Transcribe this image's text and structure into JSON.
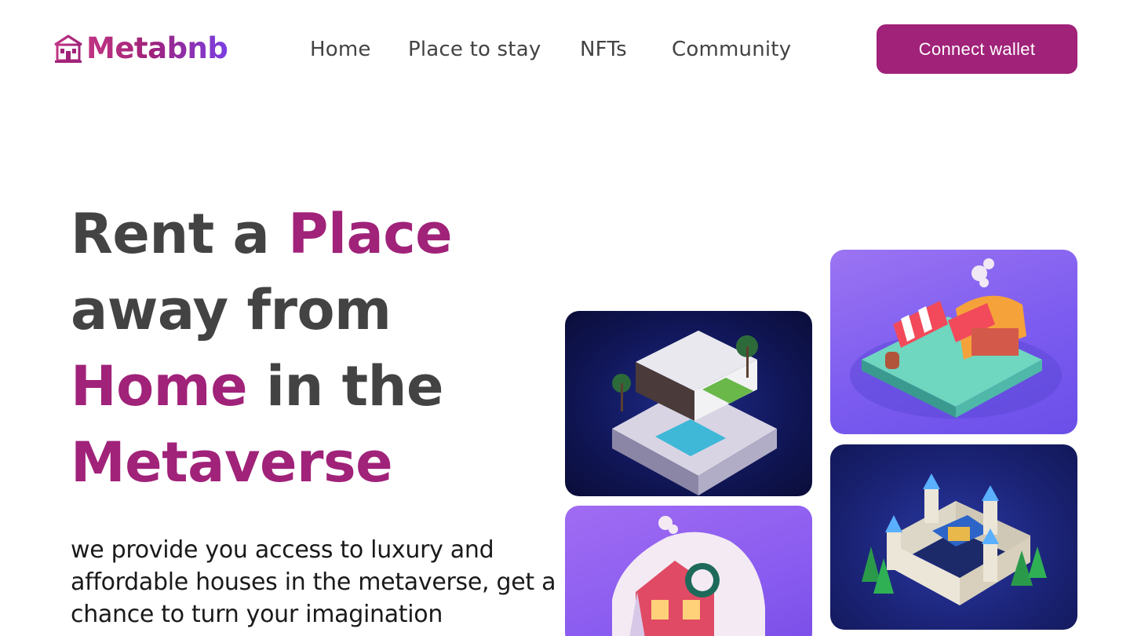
{
  "header": {
    "logo_text": "Metabnb",
    "nav": [
      "Home",
      "Place to stay",
      "NFTs",
      "Community"
    ],
    "connect_label": "Connect wallet"
  },
  "hero": {
    "line1_plain": "Rent a ",
    "line1_accent": "Place",
    "line2_plain": "away from",
    "line3_accent": "Home",
    "line3_plain": " in the",
    "line4_accent": "Metaverse",
    "subtitle": "we provide you access to luxury and affordable houses in the metaverse, get a chance to turn your imagination"
  },
  "cards": [
    "villa-pool",
    "market-stall",
    "winter-cottage",
    "castle"
  ],
  "colors": {
    "brand": "#a02279",
    "logo_gradient_end": "#7b3fe4",
    "text": "#434343"
  },
  "icons": [
    "house-icon"
  ]
}
